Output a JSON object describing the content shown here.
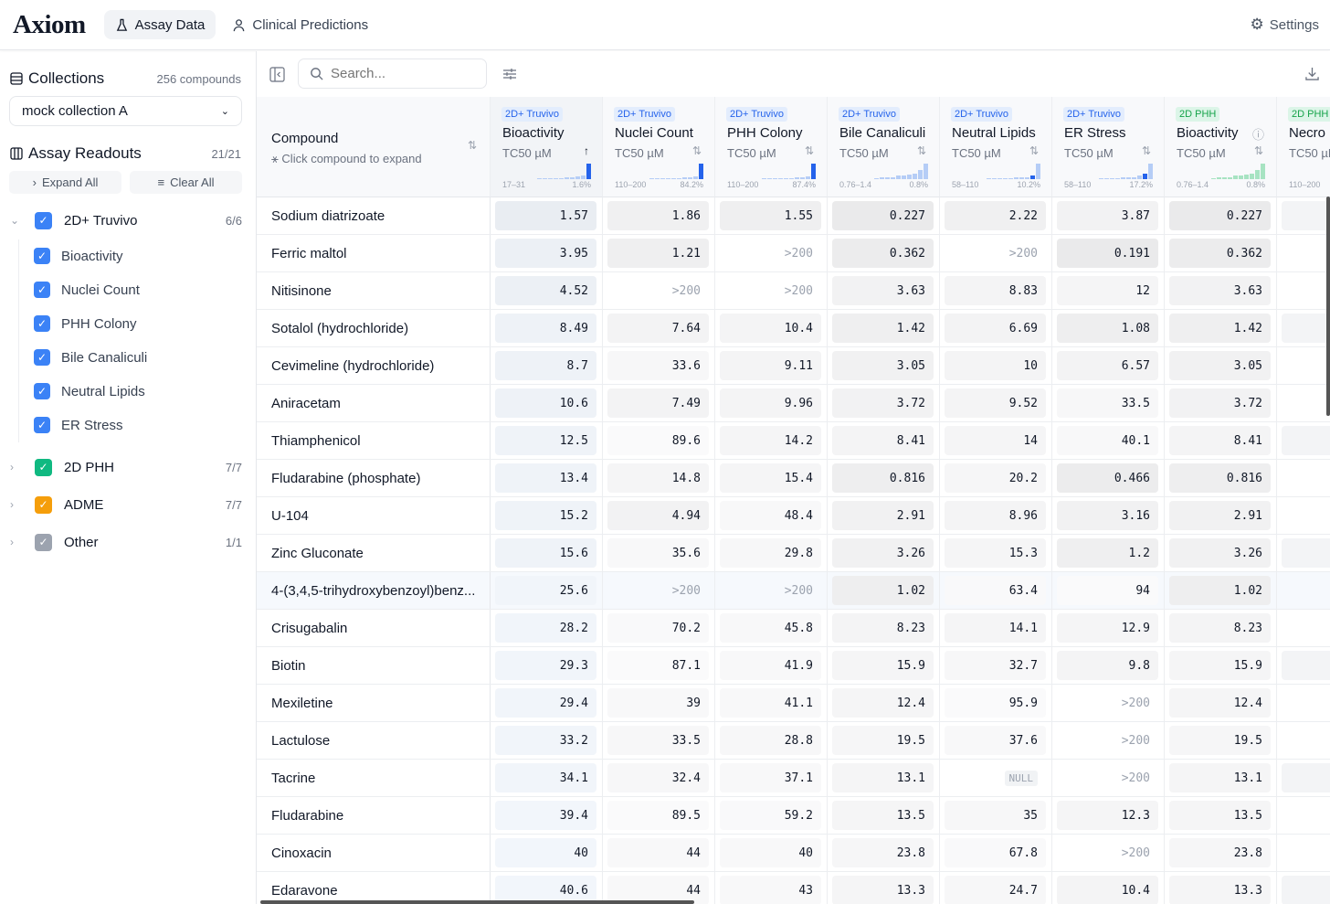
{
  "app": {
    "logo": "Axiom",
    "tabs": [
      {
        "label": "Assay Data",
        "icon": "flask-icon",
        "active": true
      },
      {
        "label": "Clinical Predictions",
        "icon": "person-icon",
        "active": false
      }
    ],
    "settings": "Settings"
  },
  "sidebar": {
    "collections": {
      "title": "Collections",
      "count": "256 compounds",
      "selected": "mock collection A"
    },
    "readouts": {
      "title": "Assay Readouts",
      "count": "21/21",
      "expand_all": "Expand All",
      "clear_all": "Clear All"
    },
    "groups": [
      {
        "label": "2D+ Truvivo",
        "count": "6/6",
        "color": "#3b82f6",
        "expanded": true,
        "items": [
          "Bioactivity",
          "Nuclei Count",
          "PHH Colony",
          "Bile Canaliculi",
          "Neutral Lipids",
          "ER Stress"
        ]
      },
      {
        "label": "2D PHH",
        "count": "7/7",
        "color": "#10b981",
        "expanded": false
      },
      {
        "label": "ADME",
        "count": "7/7",
        "color": "#f59e0b",
        "expanded": false
      },
      {
        "label": "Other",
        "count": "1/1",
        "color": "#9ca3af",
        "expanded": false
      }
    ]
  },
  "toolbar": {
    "search_placeholder": "Search..."
  },
  "table": {
    "compound_header": "Compound",
    "compound_hint": "Click compound to expand",
    "colors": {
      "truvivo_tag_bg": "#e3edfd",
      "truvivo_tag_fg": "#2563eb",
      "phh_tag_bg": "#dcf5e8",
      "phh_tag_fg": "#16a34a"
    },
    "columns": [
      {
        "tag": "2D+ Truvivo",
        "title": "Bioactivity",
        "unit": "TC50 µM",
        "sort": "asc",
        "range": "17–31",
        "pct": "1.6%",
        "hist": [
          0,
          0,
          0,
          0,
          0,
          1,
          1,
          2,
          3,
          14
        ],
        "hl": 9,
        "family": "truvivo"
      },
      {
        "tag": "2D+ Truvivo",
        "title": "Nuclei Count",
        "unit": "TC50 µM",
        "sort": "none",
        "range": "110–200",
        "pct": "84.2%",
        "hist": [
          0,
          0,
          0,
          0,
          0,
          0,
          1,
          1,
          2,
          16
        ],
        "hl": 9,
        "family": "truvivo"
      },
      {
        "tag": "2D+ Truvivo",
        "title": "PHH Colony",
        "unit": "TC50 µM",
        "sort": "none",
        "range": "110–200",
        "pct": "87.4%",
        "hist": [
          0,
          0,
          0,
          0,
          0,
          0,
          1,
          1,
          2,
          16
        ],
        "hl": 9,
        "family": "truvivo"
      },
      {
        "tag": "2D+ Truvivo",
        "title": "Bile Canaliculi",
        "unit": "TC50 µM",
        "sort": "none",
        "range": "0.76–1.4",
        "pct": "0.8%",
        "hist": [
          0,
          1,
          1,
          1,
          2,
          2,
          3,
          4,
          7,
          12
        ],
        "hl": -1,
        "family": "truvivo"
      },
      {
        "tag": "2D+ Truvivo",
        "title": "Neutral Lipids",
        "unit": "TC50 µM",
        "sort": "none",
        "range": "58–110",
        "pct": "10.2%",
        "hist": [
          0,
          0,
          0,
          0,
          0,
          1,
          1,
          1,
          3,
          16
        ],
        "hl": 8,
        "family": "truvivo"
      },
      {
        "tag": "2D+ Truvivo",
        "title": "ER Stress",
        "unit": "TC50 µM",
        "sort": "none",
        "range": "58–110",
        "pct": "17.2%",
        "hist": [
          0,
          0,
          0,
          0,
          1,
          1,
          1,
          3,
          5,
          16
        ],
        "hl": 8,
        "family": "truvivo"
      },
      {
        "tag": "2D PHH",
        "title": "Bioactivity",
        "unit": "TC50 µM",
        "sort": "none",
        "info": true,
        "range": "0.76–1.4",
        "pct": "0.8%",
        "hist": [
          0,
          1,
          1,
          1,
          2,
          2,
          3,
          4,
          7,
          12
        ],
        "hl": -1,
        "family": "phh"
      },
      {
        "tag": "2D PHH",
        "title": "Necro",
        "unit": "TC50 µM",
        "sort": "none",
        "range": "110–200",
        "pct": "",
        "hist": [],
        "hl": -1,
        "family": "phh"
      }
    ],
    "rows": [
      {
        "name": "Sodium diatrizoate",
        "values": [
          "1.57",
          "1.86",
          "1.55",
          "0.227",
          "2.22",
          "3.87",
          "0.227",
          ""
        ]
      },
      {
        "name": "Ferric maltol",
        "values": [
          "3.95",
          "1.21",
          ">200",
          "0.362",
          ">200",
          "0.191",
          "0.362",
          ""
        ]
      },
      {
        "name": "Nitisinone",
        "values": [
          "4.52",
          ">200",
          ">200",
          "3.63",
          "8.83",
          "12",
          "3.63",
          ""
        ]
      },
      {
        "name": "Sotalol (hydrochloride)",
        "values": [
          "8.49",
          "7.64",
          "10.4",
          "1.42",
          "6.69",
          "1.08",
          "1.42",
          ""
        ]
      },
      {
        "name": "Cevimeline (hydrochloride)",
        "values": [
          "8.7",
          "33.6",
          "9.11",
          "3.05",
          "10",
          "6.57",
          "3.05",
          ""
        ]
      },
      {
        "name": "Aniracetam",
        "values": [
          "10.6",
          "7.49",
          "9.96",
          "3.72",
          "9.52",
          "33.5",
          "3.72",
          ""
        ]
      },
      {
        "name": "Thiamphenicol",
        "values": [
          "12.5",
          "89.6",
          "14.2",
          "8.41",
          "14",
          "40.1",
          "8.41",
          ""
        ]
      },
      {
        "name": "Fludarabine (phosphate)",
        "values": [
          "13.4",
          "14.8",
          "15.4",
          "0.816",
          "20.2",
          "0.466",
          "0.816",
          ""
        ]
      },
      {
        "name": "U-104",
        "values": [
          "15.2",
          "4.94",
          "48.4",
          "2.91",
          "8.96",
          "3.16",
          "2.91",
          ""
        ]
      },
      {
        "name": "Zinc Gluconate",
        "values": [
          "15.6",
          "35.6",
          "29.8",
          "3.26",
          "15.3",
          "1.2",
          "3.26",
          ""
        ]
      },
      {
        "name": "4-(3,4,5-trihydroxybenzoyl)benz...",
        "values": [
          "25.6",
          ">200",
          ">200",
          "1.02",
          "63.4",
          "94",
          "1.02",
          ""
        ],
        "highlighted": true
      },
      {
        "name": "Crisugabalin",
        "values": [
          "28.2",
          "70.2",
          "45.8",
          "8.23",
          "14.1",
          "12.9",
          "8.23",
          ""
        ]
      },
      {
        "name": "Biotin",
        "values": [
          "29.3",
          "87.1",
          "41.9",
          "15.9",
          "32.7",
          "9.8",
          "15.9",
          ""
        ]
      },
      {
        "name": "Mexiletine",
        "values": [
          "29.4",
          "39",
          "41.1",
          "12.4",
          "95.9",
          ">200",
          "12.4",
          ""
        ]
      },
      {
        "name": "Lactulose",
        "values": [
          "33.2",
          "33.5",
          "28.8",
          "19.5",
          "37.6",
          ">200",
          "19.5",
          ""
        ]
      },
      {
        "name": "Tacrine",
        "values": [
          "34.1",
          "32.4",
          "37.1",
          "13.1",
          "NULL",
          ">200",
          "13.1",
          ""
        ]
      },
      {
        "name": "Fludarabine",
        "values": [
          "39.4",
          "89.5",
          "59.2",
          "13.5",
          "35",
          "12.3",
          "13.5",
          ""
        ]
      },
      {
        "name": "Cinoxacin",
        "values": [
          "40",
          "44",
          "40",
          "23.8",
          "67.8",
          ">200",
          "23.8",
          ""
        ]
      },
      {
        "name": "Edaravone",
        "values": [
          "40.6",
          "44",
          "43",
          "13.3",
          "24.7",
          "10.4",
          "13.3",
          ""
        ]
      }
    ]
  }
}
